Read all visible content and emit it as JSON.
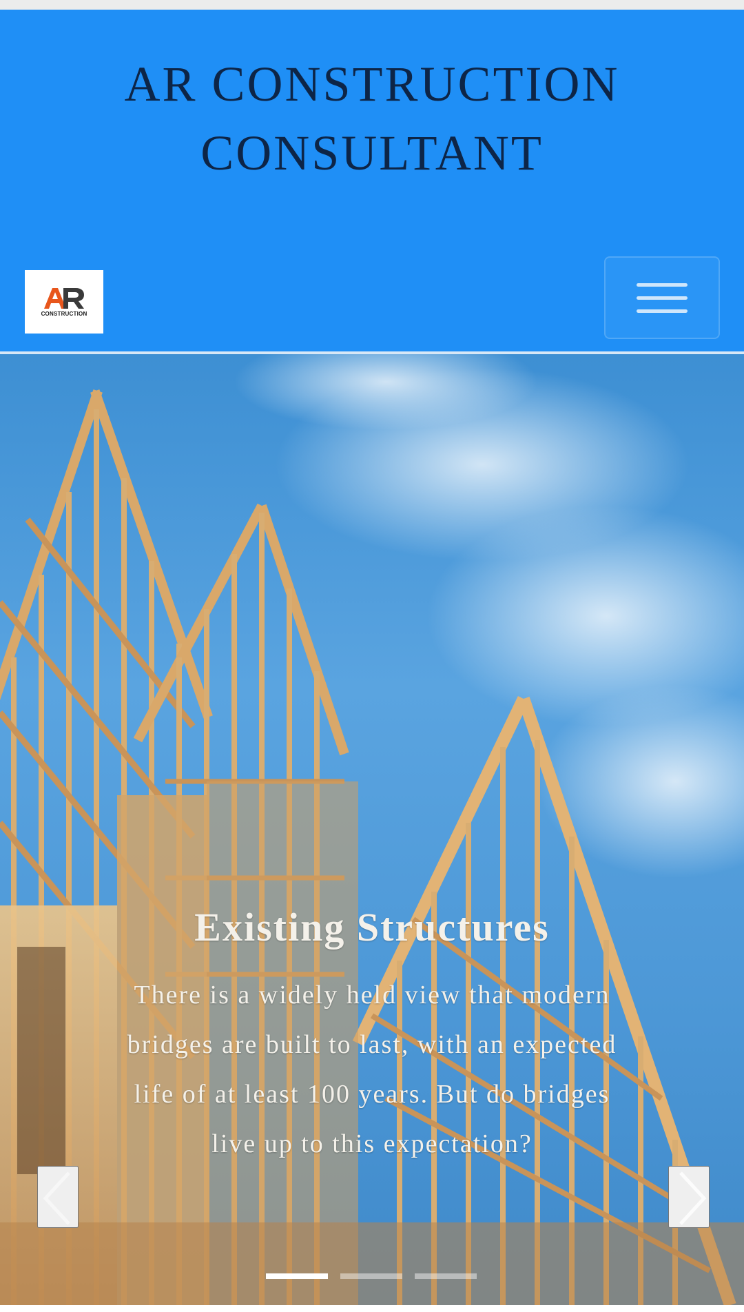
{
  "header": {
    "title_line1": "AR CONSTRUCTION",
    "title_line2": "CONSULTANT",
    "background": "#1f8ff6",
    "title_color": "#0d2547"
  },
  "logo": {
    "letters": "AR",
    "subtitle": "CONSTRUCTION",
    "colors": {
      "a": "#e8561c",
      "r": "#3a3a3a"
    }
  },
  "nav": {
    "menu_icon": "hamburger-icon"
  },
  "carousel": {
    "caption_title": "Existing Structures",
    "caption_text": "There is a widely held view that modern bridges are built to last, with an expected life of at least 100 years. But do bridges live up to this expectation?",
    "slides_total": 3,
    "active_slide": 1,
    "prev_icon": "chevron-left-icon",
    "next_icon": "chevron-right-icon"
  }
}
